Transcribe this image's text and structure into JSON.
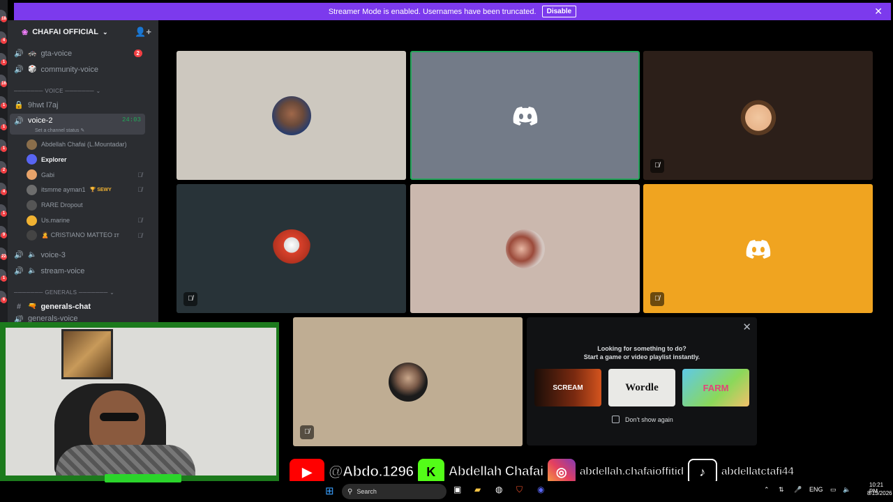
{
  "banner": {
    "text": "Streamer Mode is enabled. Usernames have been truncated.",
    "button": "Disable"
  },
  "server": {
    "name": "CHAFAI OFFICIAL"
  },
  "rail_badges": [
    "18",
    "4",
    "1",
    "16",
    "1",
    "1",
    "1",
    "2",
    "4",
    "1",
    "9",
    "22",
    "1",
    "6"
  ],
  "channels": [
    {
      "icon": "speaker-icon",
      "emoji": "🚓",
      "name": "gta-voice",
      "badge": "2"
    },
    {
      "icon": "speaker-icon",
      "emoji": "🎲",
      "name": "community-voice",
      "badge": ""
    }
  ],
  "categories": {
    "voice": "VOICE",
    "generals": "GENERALS"
  },
  "locked_channel": "9hwt l7aj",
  "active_channel": {
    "name": "voice-2",
    "timer": "24:03",
    "status": "Set a channel status"
  },
  "voice_users": [
    {
      "name": "Abdellah Chafai (L.Mountadar)",
      "muted": false,
      "tag": "",
      "color": "#8a6e4b"
    },
    {
      "name": "Explorer",
      "muted": false,
      "tag": "",
      "color": "#5865f2",
      "bold": true
    },
    {
      "name": "Gabi",
      "muted": true,
      "tag": "",
      "color": "#e8a36a"
    },
    {
      "name": "itsmme ayman1",
      "muted": true,
      "tag": "🏆 SEWY",
      "color": "#6d6d6d"
    },
    {
      "name": "RARE Dropout",
      "muted": false,
      "tag": "",
      "color": "#555"
    },
    {
      "name": "Us.marine",
      "muted": true,
      "tag": "",
      "color": "#f0b232"
    },
    {
      "name": "🙎 CRISTIANO MATTEO ɪᴛ",
      "muted": true,
      "tag": "",
      "color": "#444"
    }
  ],
  "more_channels": [
    {
      "name": "voice-3"
    },
    {
      "name": "stream-voice"
    }
  ],
  "text_channel": {
    "emoji": "🔫",
    "name": "generals-chat"
  },
  "partial_channel": "generals-voice",
  "activity": {
    "line1": "Looking for something to do?",
    "line2": "Start a game or video playlist instantly.",
    "games": [
      "SCREAM",
      "Wordle",
      "FARM"
    ],
    "checkbox": "Don't show again"
  },
  "social": {
    "youtube": "@Abdo.1296",
    "kick": "Abdellah Chafai",
    "instagram": "abdellah.chafaioffitid",
    "tiktok": "abdellatctafi44"
  },
  "taskbar": {
    "search": "Search",
    "lang": "ENG",
    "time": "10:21 PM",
    "date": "8/13/2026"
  },
  "colors": {
    "accent": "#7c3aed",
    "discord": "#5865f2",
    "speaking": "#23a559",
    "stream_green": "#1c7a1c"
  }
}
